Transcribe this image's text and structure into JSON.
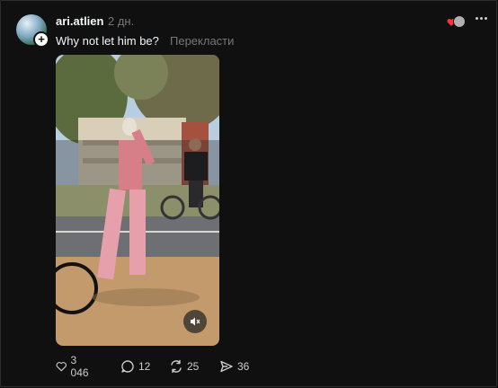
{
  "post": {
    "username": "ari.atlien",
    "time": "2 дн.",
    "text": "Why not let him be?",
    "translate": "Перекласти"
  },
  "icons": {
    "avatar_plus": "+",
    "more": "more-dots-icon",
    "mute": "muted-speaker-icon"
  },
  "colors": {
    "background": "#101010",
    "text": "#f3f5f7",
    "muted": "#777777",
    "heart": "#ff3040"
  },
  "actions": {
    "likes": "3 046",
    "comments": "12",
    "reposts": "25",
    "shares": "36"
  }
}
